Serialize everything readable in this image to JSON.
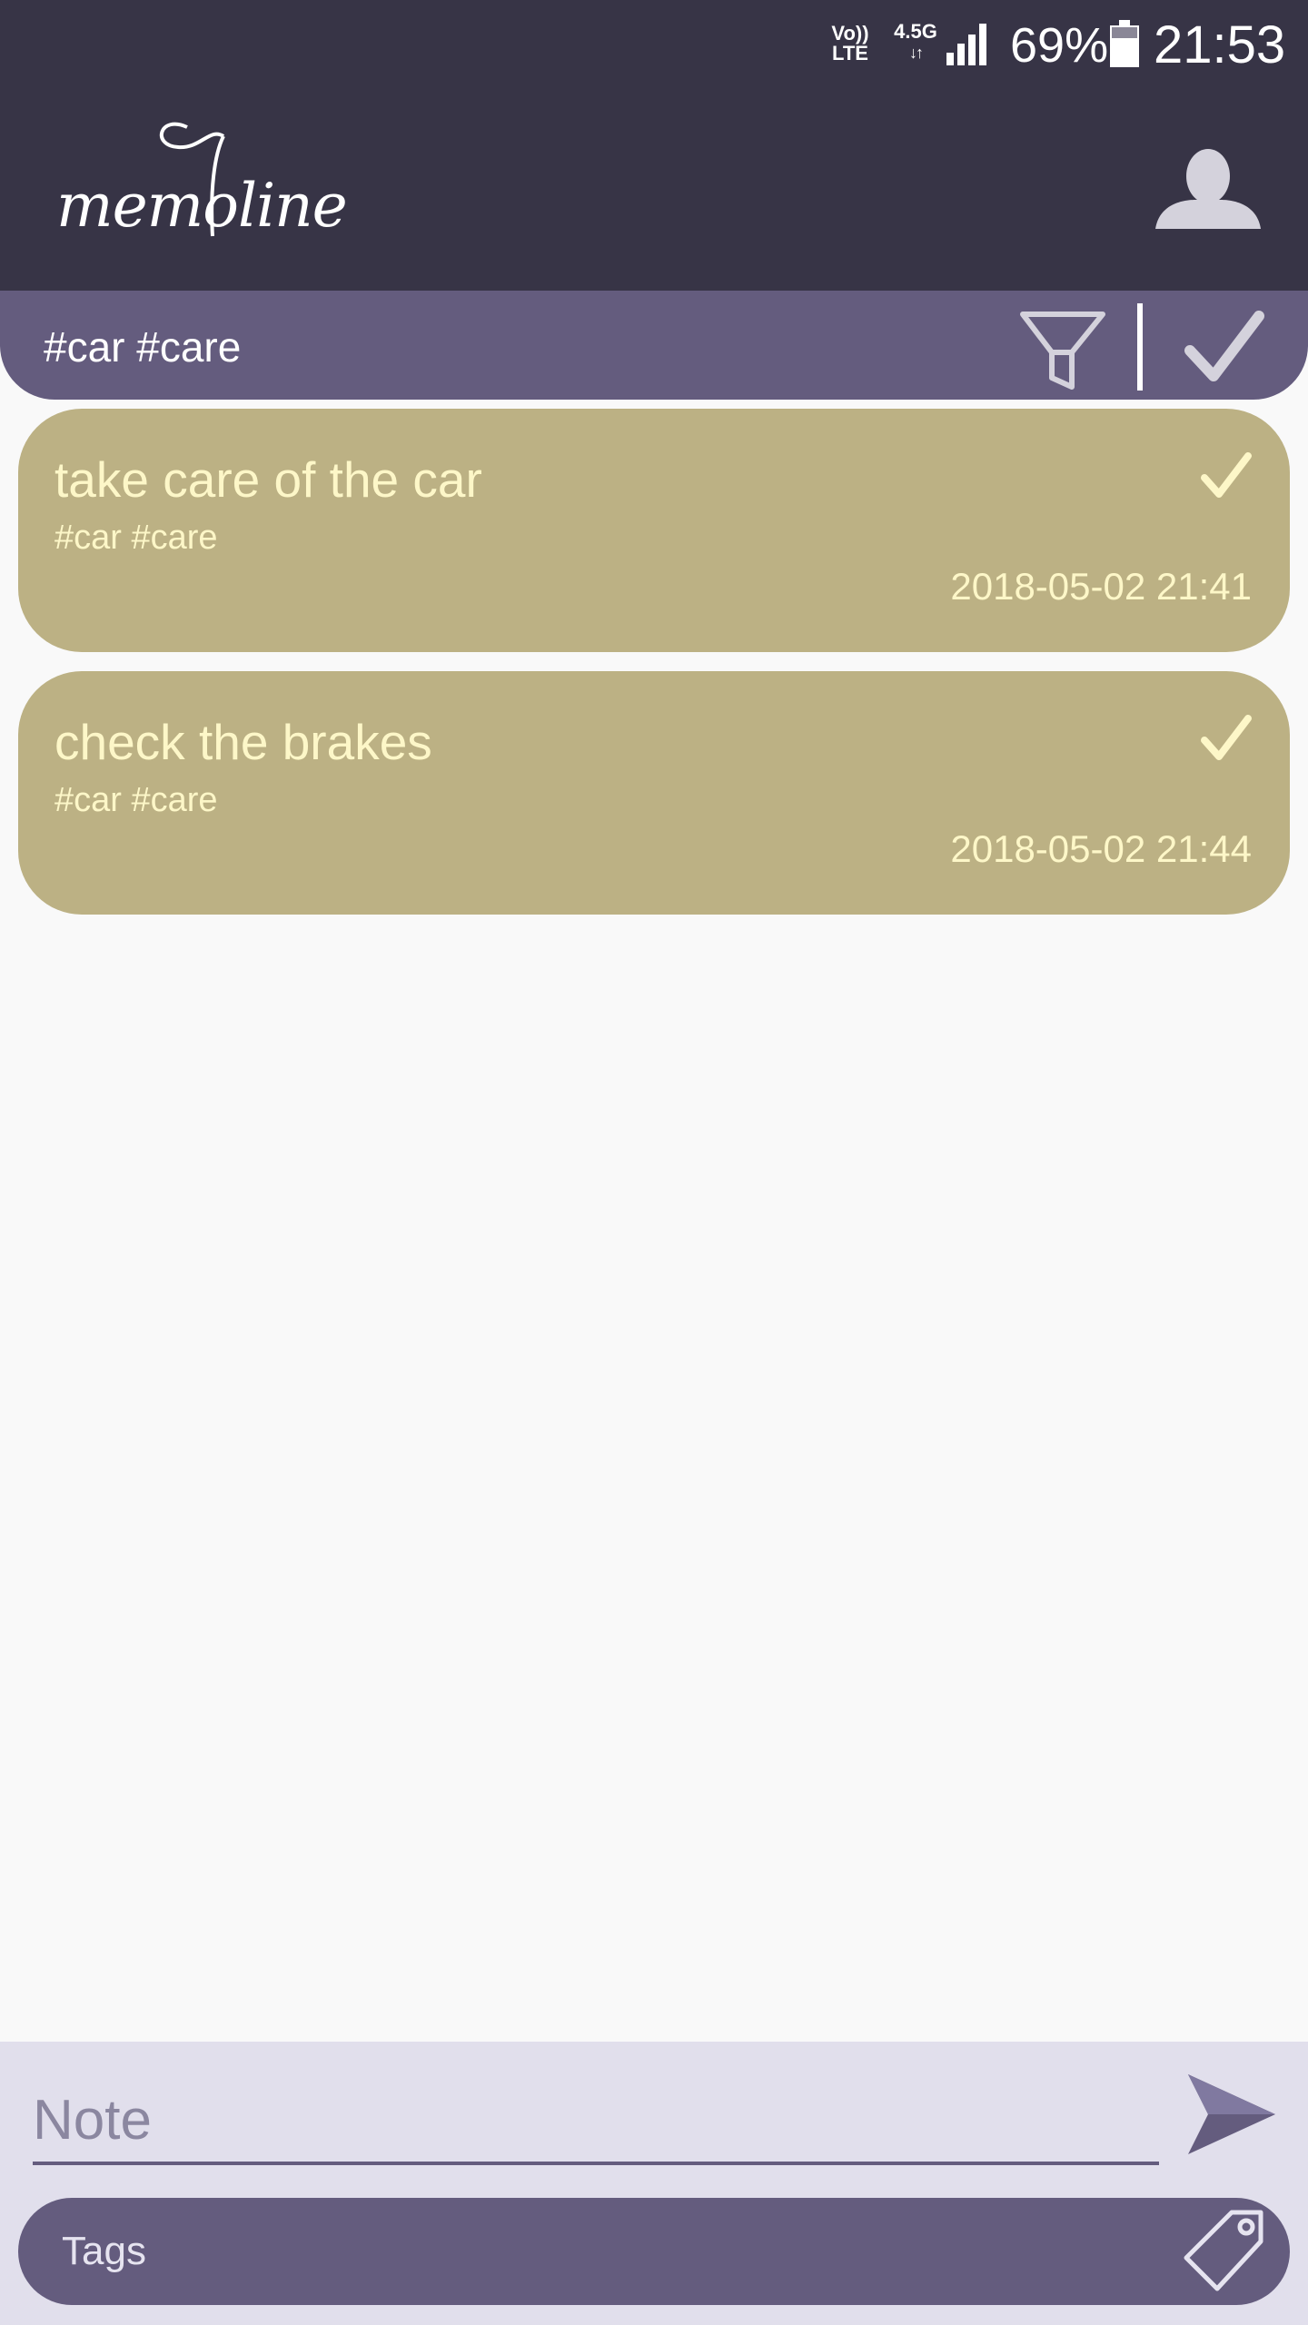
{
  "status_bar": {
    "volte_line1": "Vo))",
    "volte_line2": "LTE",
    "network": "4.5G",
    "network_arrows": "↓↑",
    "battery": "69%",
    "time": "21:53"
  },
  "header": {
    "logo_text": "memoline",
    "profile_icon": "user-icon"
  },
  "filter_bar": {
    "filter_text": "#car #care",
    "filter_icon": "funnel-icon",
    "done_icon": "checkmark-icon"
  },
  "notes": [
    {
      "title": "take care of the car",
      "tags": "#car #care",
      "date": "2018-05-02 21:41"
    },
    {
      "title": "check the brakes",
      "tags": "#car #care",
      "date": "2018-05-02 21:44"
    }
  ],
  "composer": {
    "note_placeholder": "Note",
    "tags_placeholder": "Tags",
    "send_icon": "send-icon",
    "tag_icon": "tag-icon"
  },
  "colors": {
    "header_bg": "#373446",
    "accent": "#645c7e",
    "note_bg": "#bcb184",
    "note_text": "#fdf7c8",
    "page_bg": "#f9f9f9",
    "composer_bg": "#e1dfec"
  }
}
